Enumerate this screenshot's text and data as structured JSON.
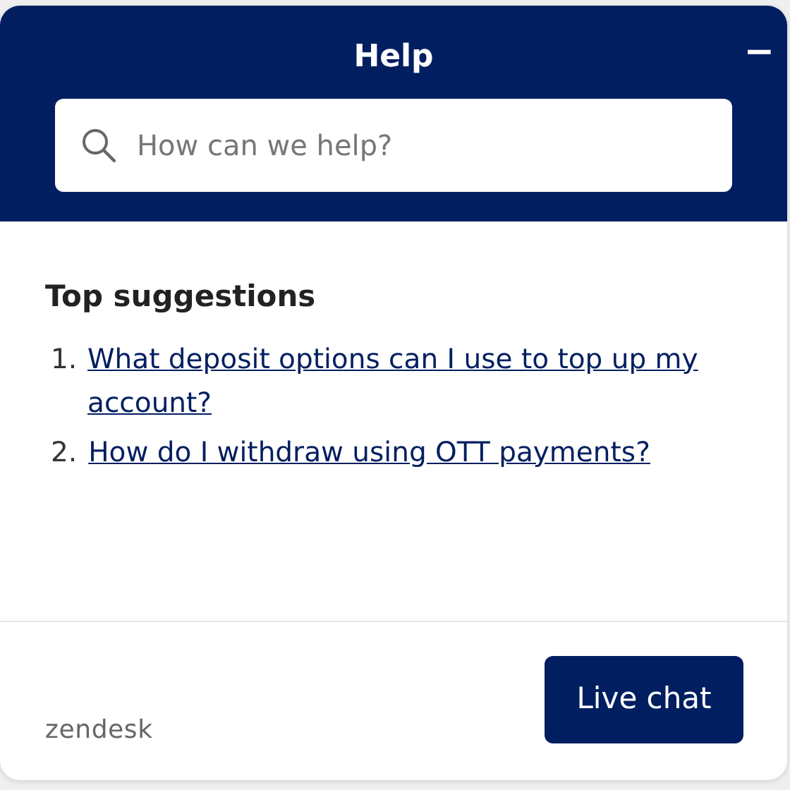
{
  "header": {
    "title": "Help",
    "minimize": "−"
  },
  "search": {
    "placeholder": "How can we help?"
  },
  "suggestions": {
    "title": "Top suggestions",
    "items": [
      {
        "number": "1.",
        "text": "What deposit options can I use to top up my account?"
      },
      {
        "number": "2.",
        "text": "How do I withdraw using OTT payments?"
      }
    ]
  },
  "footer": {
    "brand": "zendesk",
    "button": "Live chat"
  }
}
